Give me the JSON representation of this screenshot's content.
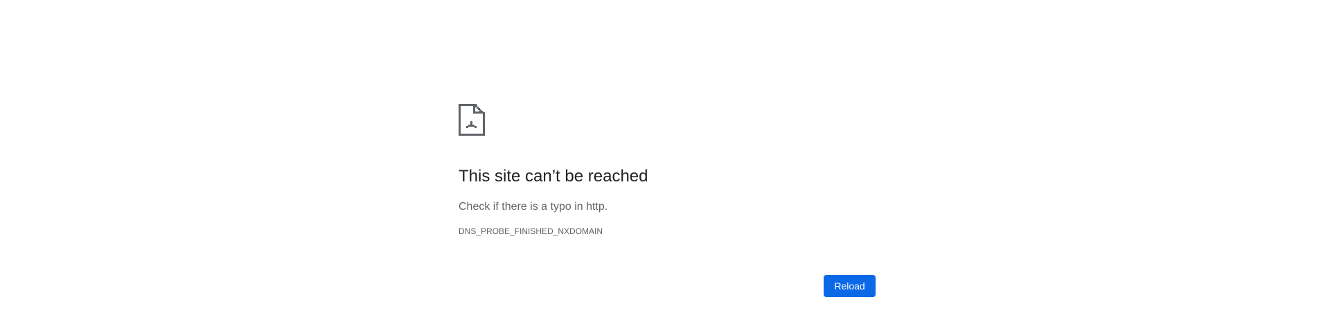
{
  "error": {
    "icon": "sad-page-icon",
    "title": "This site can’t be reached",
    "message": "Check if there is a typo in http.",
    "code": "DNS_PROBE_FINISHED_NXDOMAIN"
  },
  "actions": {
    "reload_label": "Reload"
  },
  "colors": {
    "background": "#ffffff",
    "title": "#202124",
    "body_text": "#5f6368",
    "button": "#0b68e6",
    "button_text": "#ffffff",
    "icon": "#5f6368"
  }
}
